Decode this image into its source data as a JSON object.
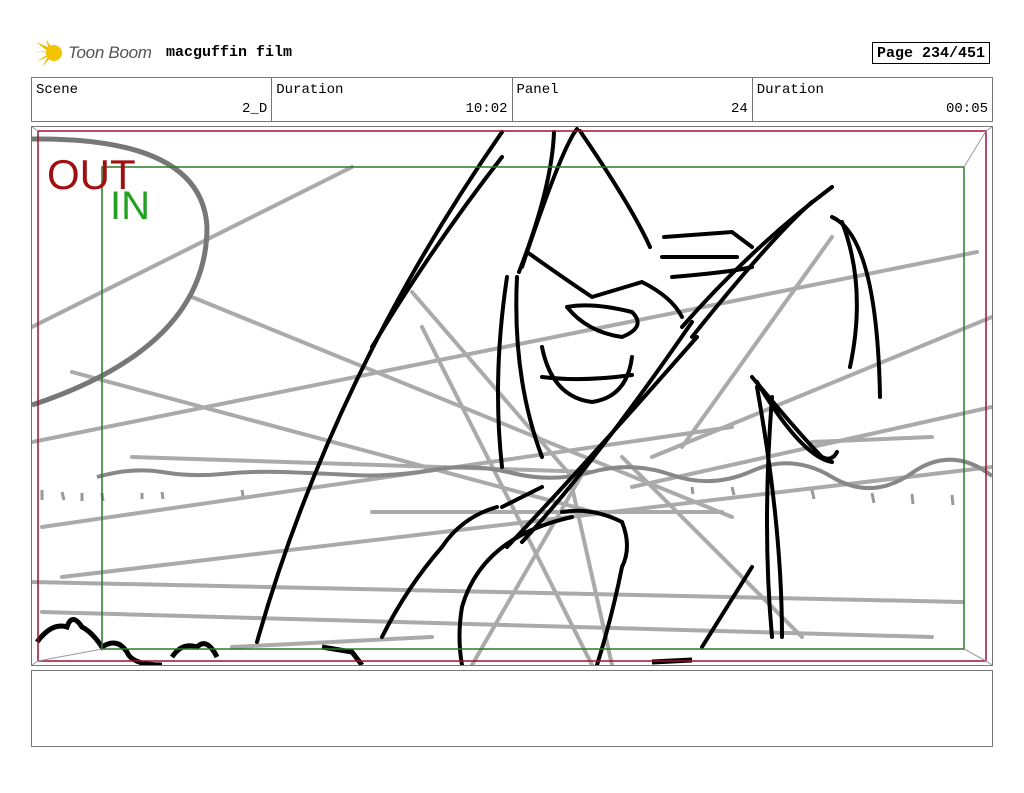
{
  "header": {
    "logo_text": "Toon Boom",
    "project_title": "macguffin film",
    "page_label": "Page 234/451"
  },
  "info_bar": {
    "scene_label": "Scene",
    "scene_value": "2_D",
    "duration_label": "Duration",
    "duration_value": "10:02",
    "panel_label": "Panel",
    "panel_value": "24",
    "panel_duration_label": "Duration",
    "panel_duration_value": "00:05"
  },
  "frame": {
    "out_label": "OUT",
    "in_label": "IN",
    "out_color": "#a01010",
    "in_color": "#22a022"
  },
  "notes": {
    "text": ""
  }
}
